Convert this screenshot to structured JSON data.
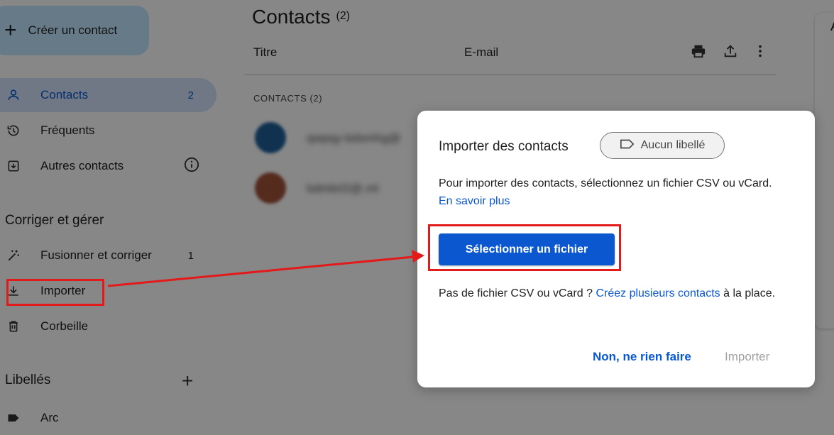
{
  "sidebar": {
    "create_label": "Créer un contact",
    "items": [
      {
        "label": "Contacts",
        "count": "2"
      },
      {
        "label": "Fréquents"
      },
      {
        "label": "Autres contacts"
      }
    ],
    "section_manage": "Corriger et gérer",
    "manage_items": [
      {
        "label": "Fusionner et corriger",
        "count": "1"
      },
      {
        "label": "Importer"
      },
      {
        "label": "Corbeille"
      }
    ],
    "section_labels": "Libellés",
    "labels": [
      {
        "label": "Arc"
      }
    ]
  },
  "main": {
    "title": "Contacts",
    "title_count": "(2)",
    "col_title": "Titre",
    "col_email": "E-mail",
    "list_header": "CONTACTS (2)",
    "rows": [
      {
        "blurred_text": "qwpqy-bdsmhg@"
      },
      {
        "blurred_text": "bdmbrl2@.ml"
      }
    ]
  },
  "right_panel": {
    "letter": "A"
  },
  "dialog": {
    "title": "Importer des contacts",
    "chip_label": "Aucun libellé",
    "desc_text": "Pour importer des contacts, sélectionnez un fichier CSV ou vCard.",
    "desc_link": "En savoir plus",
    "select_button": "Sélectionner un fichier",
    "no_file_text": "Pas de fichier CSV ou vCard ?",
    "no_file_link": "Créez plusieurs contacts",
    "no_file_tail": "à la place.",
    "cancel_label": "Non, ne rien faire",
    "import_label": "Importer"
  },
  "colors": {
    "accent": "#0b57d0",
    "highlight": "#e41a1a",
    "active_nav": "#d3e3fd",
    "create_button": "#c2e7ff"
  }
}
